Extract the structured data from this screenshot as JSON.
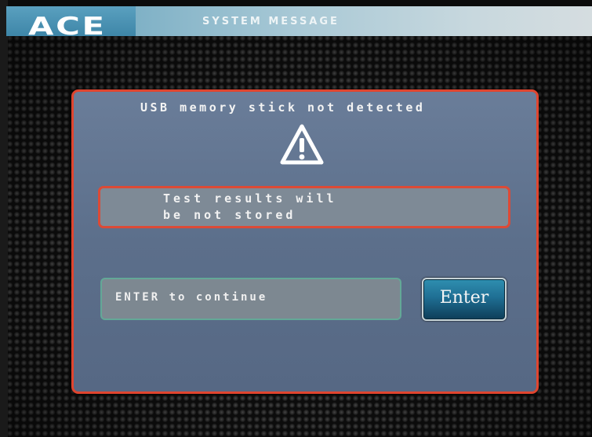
{
  "header": {
    "logo_text": "ACE",
    "title": "SYSTEM MESSAGE"
  },
  "dialog": {
    "title": "USB memory stick not detected",
    "icon": "warning-triangle-icon",
    "message": "Test results will\nbe not stored",
    "prompt": "ENTER to continue",
    "enter_button_label": "Enter"
  },
  "colors": {
    "dialog_border": "#e0452f",
    "dialog_background": "#5f728e",
    "header_accent": "#5aa0bf",
    "enter_button": "#1f6f94",
    "prompt_border": "#63a897"
  }
}
